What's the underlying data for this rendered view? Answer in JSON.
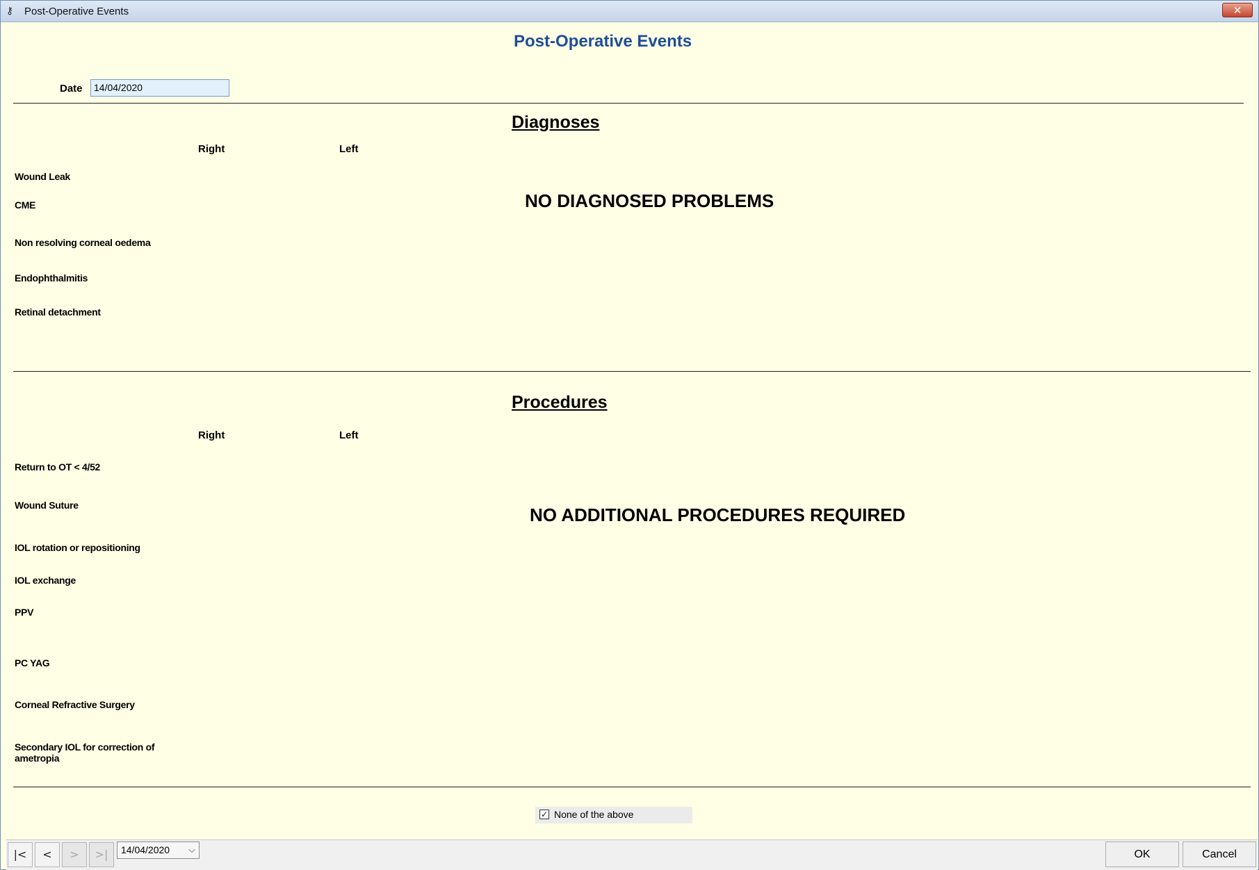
{
  "window": {
    "title": "Post-Operative Events",
    "close_glyph": "✕",
    "icon": "key-icon"
  },
  "form": {
    "title": "Post-Operative Events",
    "date_label": "Date",
    "date_value": "14/04/2020"
  },
  "diagnoses": {
    "title": "Diagnoses",
    "col_right": "Right",
    "col_left": "Left",
    "items": [
      "Wound Leak",
      "CME",
      "Non resolving corneal oedema",
      "Endophthalmitis",
      "Retinal detachment"
    ],
    "message": "NO DIAGNOSED PROBLEMS"
  },
  "procedures": {
    "title": "Procedures",
    "col_right": "Right",
    "col_left": "Left",
    "items": [
      "Return to OT < 4/52",
      "Wound Suture",
      "IOL rotation or repositioning",
      "IOL exchange",
      "PPV",
      "PC YAG",
      "Corneal Refractive Surgery",
      "Secondary IOL for correction of ametropia"
    ],
    "message": "NO ADDITIONAL PROCEDURES REQUIRED"
  },
  "none_of_above": {
    "label": "None of the above",
    "checked": true,
    "check_glyph": "✓"
  },
  "footer": {
    "nav": {
      "first": "|<",
      "prev": "<",
      "next": ">",
      "last": ">|"
    },
    "date_select": "14/04/2020",
    "chevron": "⌵",
    "ok_label": "OK",
    "cancel_label": "Cancel"
  }
}
